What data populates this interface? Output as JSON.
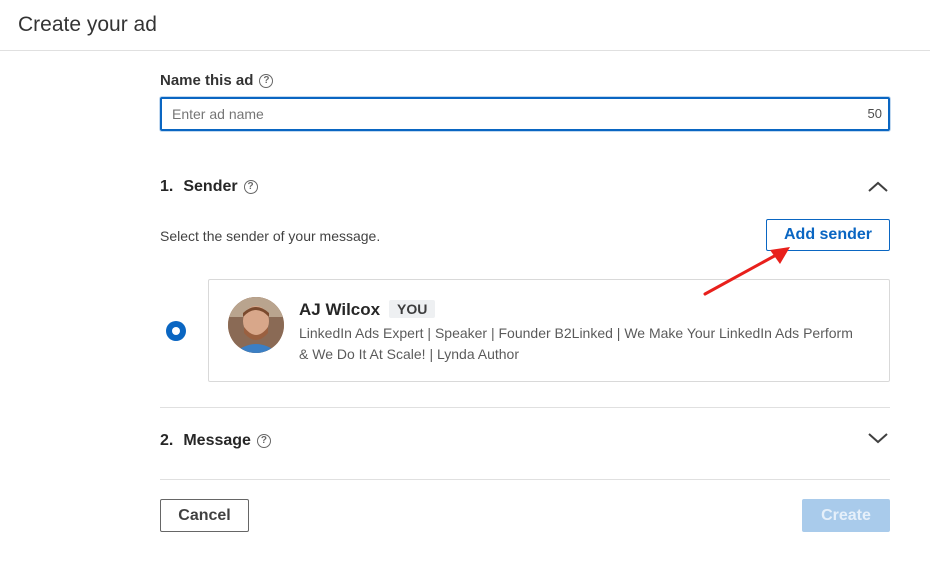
{
  "header": {
    "title": "Create your ad"
  },
  "name_field": {
    "label": "Name this ad",
    "placeholder": "Enter ad name",
    "value": "",
    "char_count": "50"
  },
  "sender_section": {
    "number": "1.",
    "title": "Sender",
    "expanded": true,
    "description": "Select the sender of your message.",
    "add_button_label": "Add sender",
    "selected_sender": {
      "name": "AJ Wilcox",
      "badge": "YOU",
      "bio": "LinkedIn Ads Expert | Speaker | Founder B2Linked | We Make Your LinkedIn Ads Perform & We Do It At Scale! | Lynda Author",
      "selected": true
    }
  },
  "message_section": {
    "number": "2.",
    "title": "Message",
    "expanded": false
  },
  "footer": {
    "cancel_label": "Cancel",
    "create_label": "Create"
  },
  "colors": {
    "accent": "#0a66c2",
    "disabled_button": "#a9cbeb",
    "annotation_arrow": "#e8201c"
  },
  "icons": {
    "help": "help-circle-icon",
    "collapse": "chevron-up-icon",
    "expand": "chevron-down-icon"
  }
}
